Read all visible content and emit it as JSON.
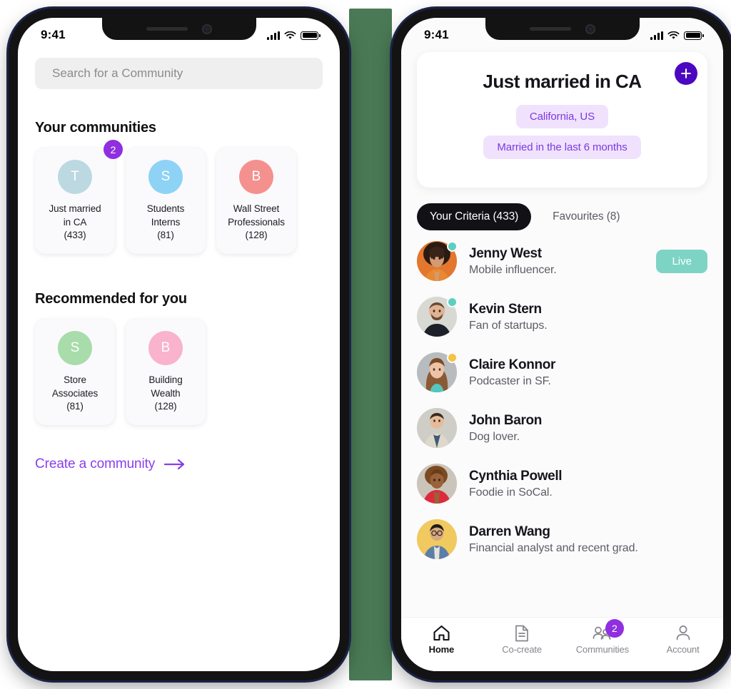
{
  "meta": {
    "accent_purple": "#4B08C0",
    "link_purple": "#8a3dec",
    "badge_purple": "#8f2fe0",
    "chip_bg": "#f0e2fd",
    "chip_text": "#7b3ae0",
    "live_green": "#7ed4c4",
    "stage_background": "#ffffff",
    "gap_background": "#4a7a55"
  },
  "status_bar": {
    "time": "9:41",
    "signal_icon": "cellular-bars-icon",
    "wifi_icon": "wifi-icon",
    "battery_icon": "battery-full-icon"
  },
  "left_screen": {
    "search": {
      "placeholder": "Search for a Community",
      "value": ""
    },
    "your_communities": {
      "title": "Your communities",
      "cards": [
        {
          "initial": "T",
          "avatar_color": "#bcd9e1",
          "dotted": true,
          "name": "Just married\nin CA\n(433)",
          "line1": "Just married",
          "line2": "in CA",
          "count": "(433)",
          "badge": "2"
        },
        {
          "initial": "S",
          "avatar_color": "#8ed3f5",
          "dotted": false,
          "line1": "Students",
          "line2": "Interns",
          "count": "(81)",
          "badge": ""
        },
        {
          "initial": "B",
          "avatar_color": "#f4918f",
          "dotted": false,
          "line1": "Wall Street",
          "line2": "Professionals",
          "count": "(128)",
          "badge": ""
        }
      ]
    },
    "recommended": {
      "title": "Recommended for you",
      "cards": [
        {
          "initial": "S",
          "avatar_color": "#a8dcaa",
          "line1": "Store",
          "line2": "Associates",
          "count": "(81)"
        },
        {
          "initial": "B",
          "avatar_color": "#f9b3cc",
          "line1": "Building",
          "line2": "Wealth",
          "count": "(128)"
        }
      ]
    },
    "create_link": {
      "label": "Create a community",
      "icon": "arrow-right-icon"
    }
  },
  "right_screen": {
    "hero": {
      "title": "Just married in CA",
      "add_icon": "plus-circle-icon",
      "chips": [
        "California, US",
        "Married in the last 6 months"
      ]
    },
    "tabs": [
      {
        "label": "Your Criteria (433)",
        "active": true
      },
      {
        "label": "Favourites (8)",
        "active": false
      }
    ],
    "people": [
      {
        "name": "Jenny West",
        "desc": "Mobile influencer.",
        "status": "online",
        "status_color": "#5ecfbe",
        "action": "Live",
        "avatar_bg": "#e3772e",
        "avatar_hair": "#2b1a12",
        "avatar_skin": "#d39a74"
      },
      {
        "name": "Kevin Stern",
        "desc": "Fan of startups.",
        "status": "online",
        "status_color": "#5ecfbe",
        "action": "",
        "avatar_bg": "#d9d9d4",
        "avatar_hair": "#6a4a33",
        "avatar_skin": "#e0b394"
      },
      {
        "name": "Claire Konnor",
        "desc": "Podcaster in SF.",
        "status": "away",
        "status_color": "#f5c242",
        "action": "",
        "avatar_bg": "#b9bcbe",
        "avatar_hair": "#8a5a34",
        "avatar_skin": "#ecc3a6"
      },
      {
        "name": "John Baron",
        "desc": "Dog lover.",
        "status": "none",
        "status_color": "",
        "action": "",
        "avatar_bg": "#cfcec6",
        "avatar_hair": "#3b2a1e",
        "avatar_skin": "#e6bb98"
      },
      {
        "name": "Cynthia Powell",
        "desc": "Foodie in SoCal.",
        "status": "none",
        "status_color": "",
        "action": "",
        "avatar_bg": "#cbc4ba",
        "avatar_hair": "#7c4a21",
        "avatar_skin": "#9a6239"
      },
      {
        "name": "Darren Wang",
        "desc": "Financial analyst and recent grad.",
        "status": "none",
        "status_color": "",
        "action": "",
        "avatar_bg": "#f0c95f",
        "avatar_hair": "#201a17",
        "avatar_skin": "#d8a87e"
      }
    ],
    "bottom_nav": [
      {
        "label": "Home",
        "icon": "home-icon",
        "active": true,
        "badge": ""
      },
      {
        "label": "Co-create",
        "icon": "document-icon",
        "active": false,
        "badge": ""
      },
      {
        "label": "Communities",
        "icon": "people-icon",
        "active": false,
        "badge": "2"
      },
      {
        "label": "Account",
        "icon": "person-icon",
        "active": false,
        "badge": ""
      }
    ]
  }
}
